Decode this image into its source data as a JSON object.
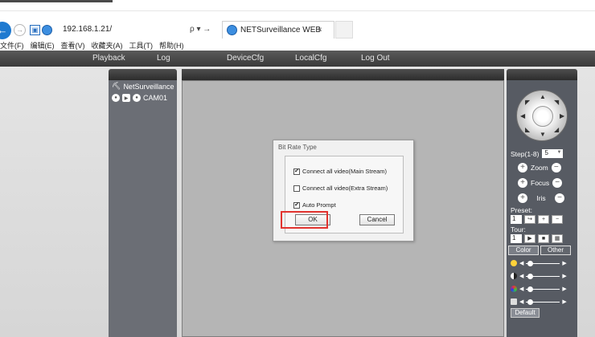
{
  "browser": {
    "address": "192.168.1.21/",
    "address_tools": "ρ ▾ →",
    "tab_title": "NETSurveillance WEB",
    "tab_close": "×",
    "menu": [
      "文件(F)",
      "编辑(E)",
      "查看(V)",
      "收藏夹(A)",
      "工具(T)",
      "帮助(H)"
    ]
  },
  "appnav": [
    "Playback",
    "Log",
    "DeviceCfg",
    "LocalCfg",
    "Log Out"
  ],
  "tree": {
    "root": "NetSurveillance",
    "camera": "CAM01"
  },
  "ptz": {
    "step_label": "Step(1-8)",
    "step_value": "5",
    "zoom": "Zoom",
    "focus": "Focus",
    "iris": "Iris",
    "preset_label": "Preset:",
    "preset_value": "1",
    "tour_label": "Tour:",
    "tour_value": "1",
    "tab_color": "Color",
    "tab_other": "Other",
    "default": "Default"
  },
  "dialog": {
    "title": "Bit Rate Type",
    "options": [
      {
        "label": "Connect all video(Main Stream)",
        "checked": true
      },
      {
        "label": "Connect all video(Extra Stream)",
        "checked": false
      },
      {
        "label": "Auto Prompt",
        "checked": true
      }
    ],
    "ok": "OK",
    "cancel": "Cancel"
  },
  "colors": {
    "highlight": "#e2332f",
    "nav_bg": "#3a3a3a",
    "panel_bg": "#575b63"
  }
}
